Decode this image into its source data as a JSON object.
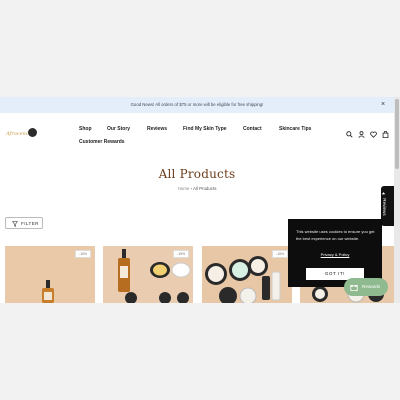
{
  "announcement": {
    "text": "Good News! All orders of $75 or more will be eligible for free shipping!",
    "close": "×"
  },
  "logo": {
    "text": "Afrocenchix"
  },
  "nav": {
    "items": [
      "Shop",
      "Our Story",
      "Reviews",
      "Find My Skin Type",
      "Contact",
      "Skincare Tips",
      "Customer Rewards"
    ]
  },
  "header_icons": [
    "search-icon",
    "account-icon",
    "wishlist-icon",
    "cart-icon"
  ],
  "page": {
    "title": "All Products"
  },
  "breadcrumb": {
    "home": "Home",
    "separator": "›",
    "current": "All Products"
  },
  "filter": {
    "label": "FILTER"
  },
  "products": [
    {
      "badge": "-15%"
    },
    {
      "badge": "-15%"
    },
    {
      "badge": "-15%"
    },
    {
      "badge": ""
    }
  ],
  "reviews_tab": {
    "label": "★ Reviews"
  },
  "cookie": {
    "text": "This website uses cookies to ensure you get the best experience on our website.",
    "policy_link": "Privacy & Policy",
    "button": "GOT IT!"
  },
  "rewards": {
    "label": "Rewards"
  },
  "colors": {
    "accent_brown": "#6b3c1a",
    "announcement_bg": "#e4eefa",
    "rewards_green": "#8fb98e",
    "product_bg": "#e9c9a8"
  }
}
